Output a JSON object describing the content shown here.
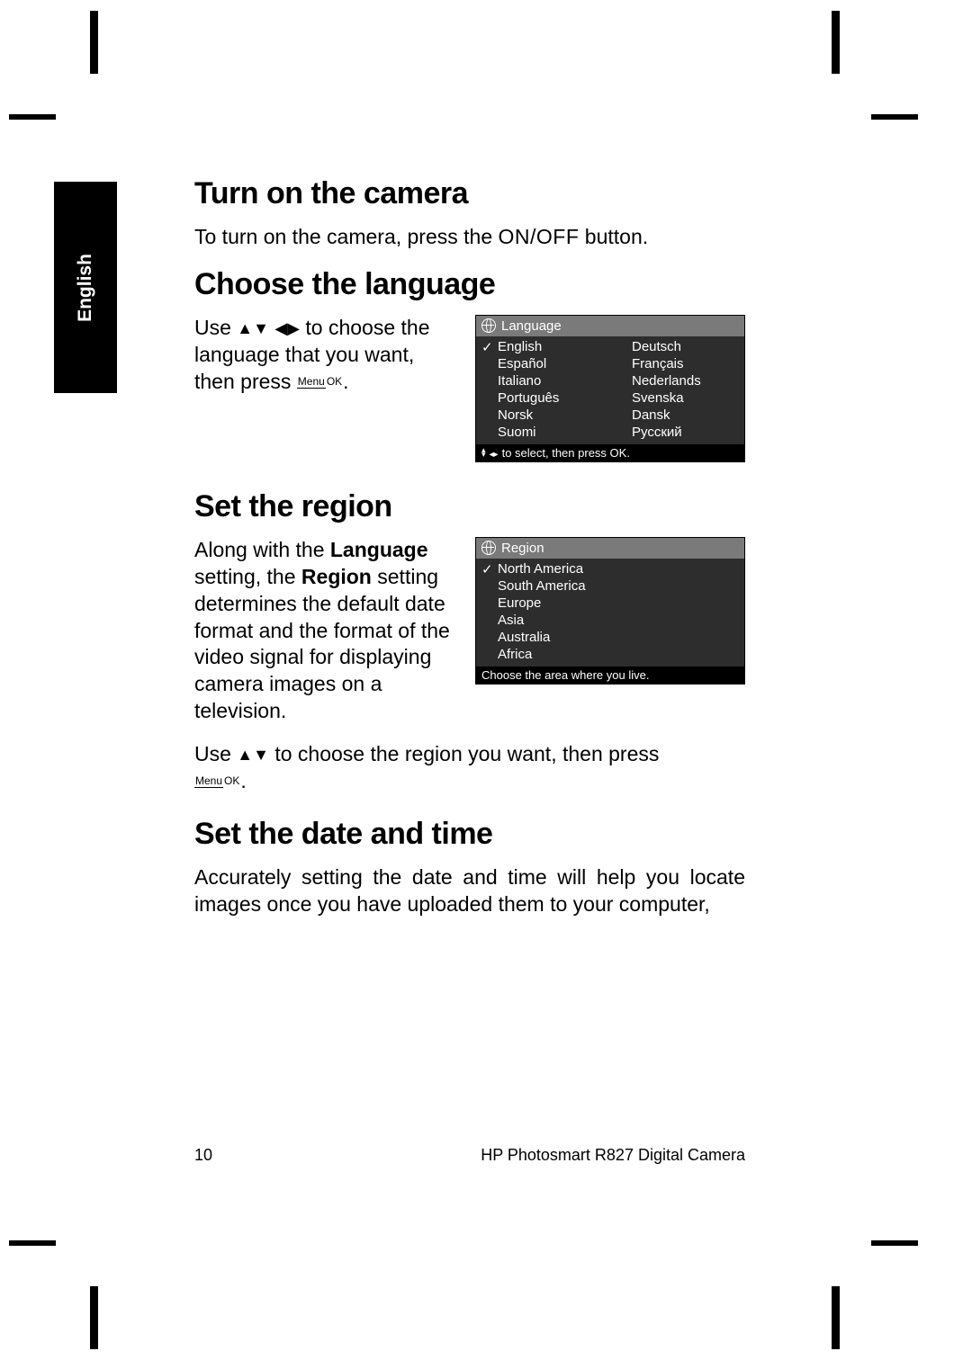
{
  "tab_label": "English",
  "sections": {
    "turn_on": {
      "heading": "Turn on the camera",
      "body_prefix": "To turn on the camera, press the ",
      "onoff_label": "ON/OFF",
      "body_suffix": " button."
    },
    "choose_lang": {
      "heading": "Choose the language",
      "body_prefix": "Use ",
      "body_mid": " to choose the language that you want, then press ",
      "body_suffix": "."
    },
    "set_region": {
      "heading": "Set the region",
      "body1_a": "Along with the ",
      "body1_b": "Language",
      "body1_c": " setting, the ",
      "body1_d": "Region",
      "body1_e": " setting determines the default date format and the format of the video signal for displaying camera images on a television.",
      "body2_a": "Use ",
      "body2_b": " to choose the region you want, then press ",
      "body2_c": "."
    },
    "set_date": {
      "heading": "Set the date and time",
      "body": "Accurately setting the date and time will help you locate images once you have uploaded them to your computer,"
    }
  },
  "menuok": {
    "top": "Menu",
    "bottom": "OK"
  },
  "lang_screen": {
    "title": "Language",
    "items_left": [
      "English",
      "Español",
      "Italiano",
      "Português",
      "Norsk",
      "Suomi"
    ],
    "items_right": [
      "Deutsch",
      "Français",
      "Nederlands",
      "Svenska",
      "Dansk",
      "Русский"
    ],
    "selected": "English",
    "footer": "to select, then press OK."
  },
  "region_screen": {
    "title": "Region",
    "items": [
      "North America",
      "South America",
      "Europe",
      "Asia",
      "Australia",
      "Africa"
    ],
    "selected": "North America",
    "footer": "Choose the area where you live."
  },
  "footer": {
    "page": "10",
    "book": "HP Photosmart R827 Digital Camera"
  }
}
